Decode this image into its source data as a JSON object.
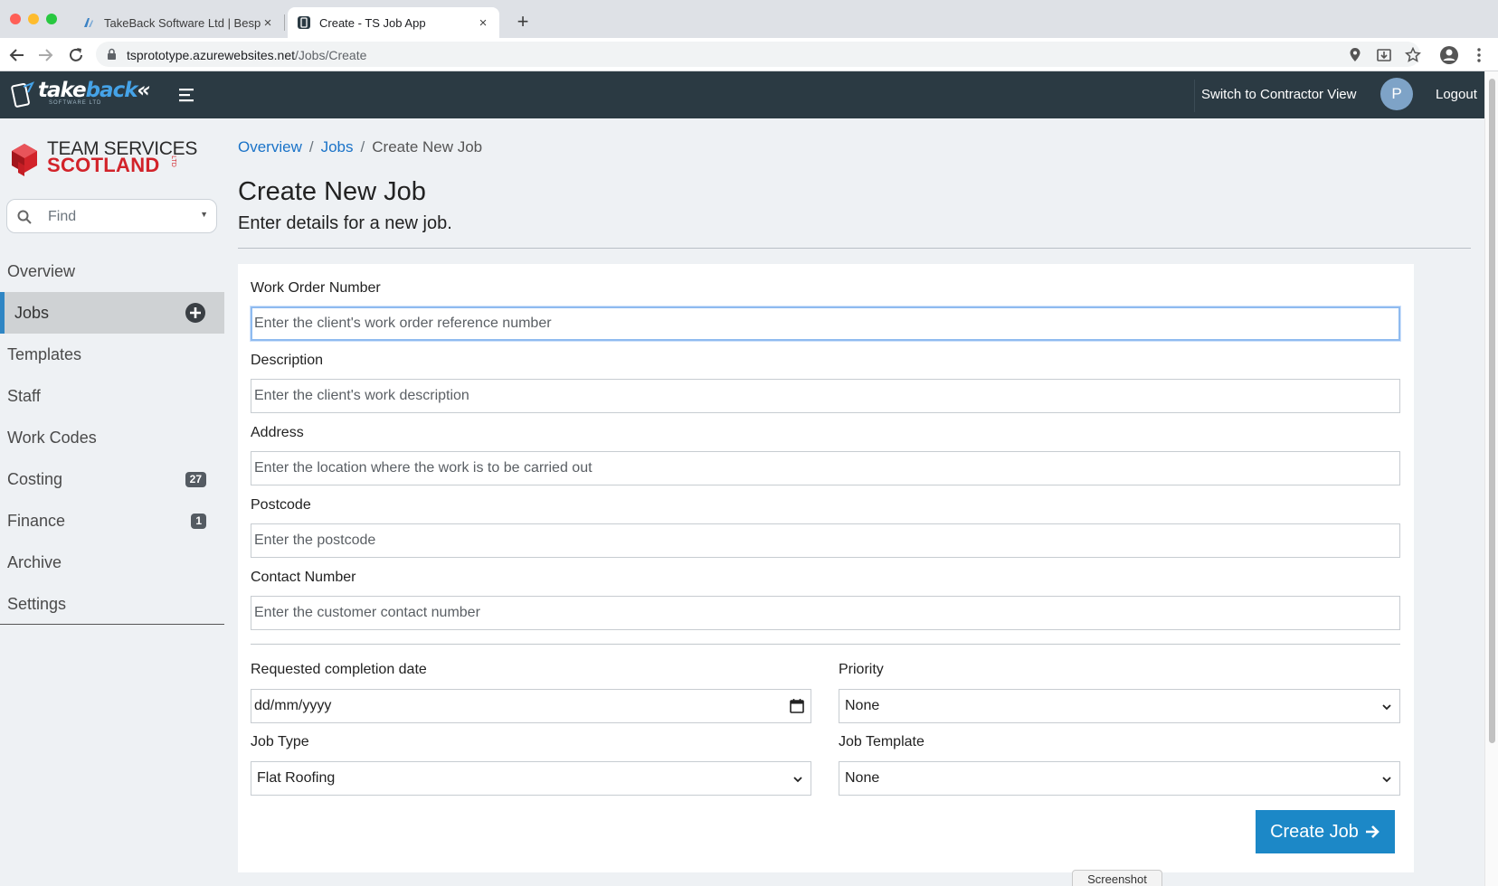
{
  "browser": {
    "tabs": [
      {
        "title": "TakeBack Software Ltd | Bespo",
        "close": "×"
      },
      {
        "title": "Create - TS Job App",
        "close": "×"
      }
    ],
    "new_tab": "+",
    "url_host": "tsprototype.azurewebsites.net",
    "url_path": "/Jobs/Create"
  },
  "header": {
    "brand_take": "take",
    "brand_back": "back",
    "brand_chevrons": "«",
    "brand_sub": "SOFTWARE LTD",
    "switch_view": "Switch to Contractor View",
    "avatar_initial": "P",
    "logout": "Logout"
  },
  "sidebar": {
    "org_line1": "TEAM SERVICES",
    "org_line2": "SCOTLAND",
    "org_ltd": "LTD",
    "find_placeholder": "Find",
    "items": [
      {
        "label": "Overview"
      },
      {
        "label": "Jobs",
        "active": true
      },
      {
        "label": "Templates"
      },
      {
        "label": "Staff"
      },
      {
        "label": "Work Codes"
      },
      {
        "label": "Costing",
        "badge": "27"
      },
      {
        "label": "Finance",
        "badge": "1"
      },
      {
        "label": "Archive"
      },
      {
        "label": "Settings"
      }
    ]
  },
  "breadcrumb": {
    "overview": "Overview",
    "jobs": "Jobs",
    "current": "Create New Job",
    "sep": "/"
  },
  "page": {
    "title": "Create New Job",
    "subtitle": "Enter details for a new job."
  },
  "form": {
    "work_order": {
      "label": "Work Order Number",
      "placeholder": "Enter the client's work order reference number"
    },
    "description": {
      "label": "Description",
      "placeholder": "Enter the client's work description"
    },
    "address": {
      "label": "Address",
      "placeholder": "Enter the location where the work is to be carried out"
    },
    "postcode": {
      "label": "Postcode",
      "placeholder": "Enter the postcode"
    },
    "contact": {
      "label": "Contact Number",
      "placeholder": "Enter the customer contact number"
    },
    "completion_date": {
      "label": "Requested completion date",
      "value": "dd/mm/yyyy"
    },
    "priority": {
      "label": "Priority",
      "value": "None"
    },
    "job_type": {
      "label": "Job Type",
      "value": "Flat Roofing"
    },
    "job_template": {
      "label": "Job Template",
      "value": "None"
    },
    "submit": "Create Job"
  },
  "tooltip": "Screenshot",
  "colors": {
    "header_bg": "#2b3a43",
    "accent": "#1c88c7",
    "active_border": "#2f86c4",
    "brand_red": "#d2232a"
  }
}
